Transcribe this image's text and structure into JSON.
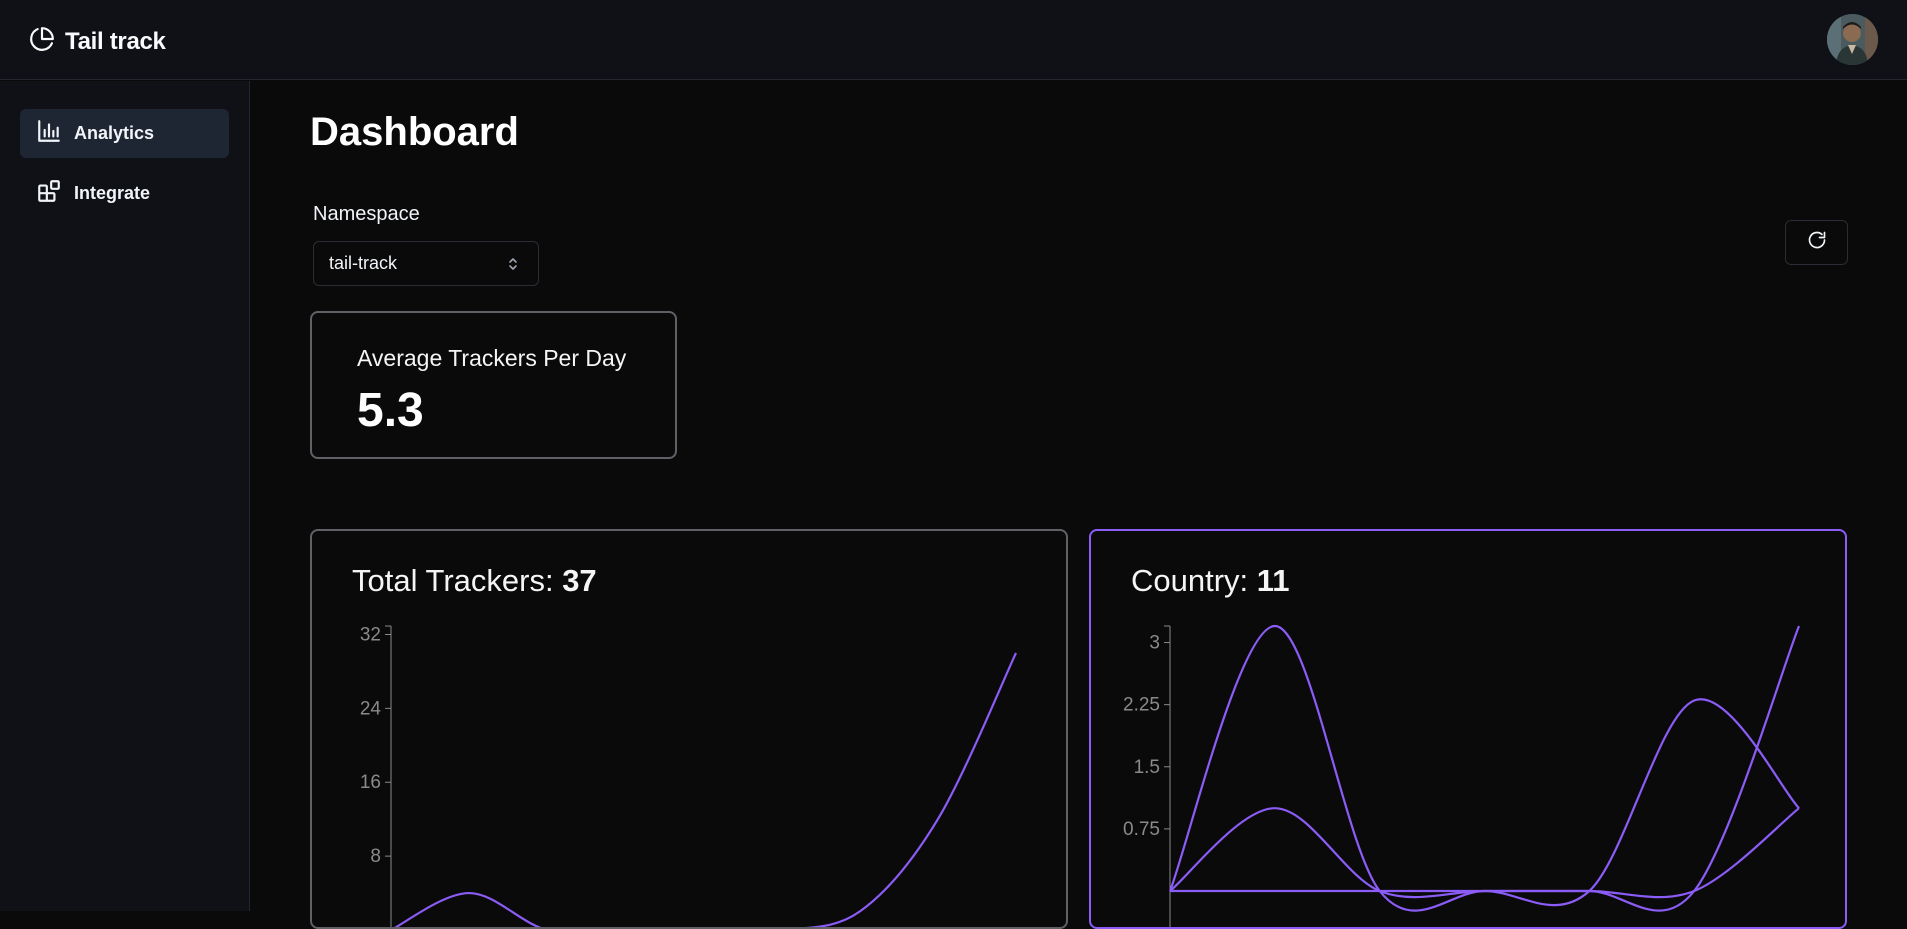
{
  "app": {
    "title": "Tail track"
  },
  "sidebar": {
    "items": [
      {
        "label": "Analytics",
        "icon": "bar-chart-icon",
        "active": true
      },
      {
        "label": "Integrate",
        "icon": "blocks-icon",
        "active": false
      }
    ]
  },
  "main": {
    "page_title": "Dashboard",
    "namespace": {
      "label": "Namespace",
      "value": "tail-track"
    },
    "stat": {
      "label": "Average Trackers Per Day",
      "value": "5.3"
    }
  },
  "colors": {
    "accent": "#8b5cf6",
    "background": "#0a0a0b",
    "panel": "#0f1117",
    "active_nav": "#1e2533"
  },
  "chart_data": [
    {
      "type": "line",
      "title": "Total Trackers: ",
      "title_value": "37",
      "y_ticks": [
        "32",
        "24",
        "16",
        "8"
      ],
      "ylim": [
        0,
        34
      ],
      "x": [
        0,
        1,
        2,
        3,
        4,
        5,
        6,
        7,
        8
      ],
      "series": [
        {
          "values": [
            0,
            4,
            0,
            0,
            0,
            0,
            2,
            12,
            30
          ]
        }
      ]
    },
    {
      "type": "line",
      "title": "Country: ",
      "title_value": "11",
      "y_ticks": [
        "3",
        "2.25",
        "1.5",
        "0.75"
      ],
      "ylim": [
        0,
        3.2
      ],
      "x": [
        0,
        1,
        2,
        3,
        4,
        5,
        6
      ],
      "series": [
        {
          "values": [
            0,
            3.2,
            0,
            0,
            0,
            2.3,
            1
          ]
        },
        {
          "values": [
            0,
            1,
            0,
            0,
            0,
            0,
            1
          ]
        },
        {
          "values": [
            0,
            0,
            0,
            0,
            0,
            0,
            3.2
          ]
        }
      ]
    }
  ]
}
